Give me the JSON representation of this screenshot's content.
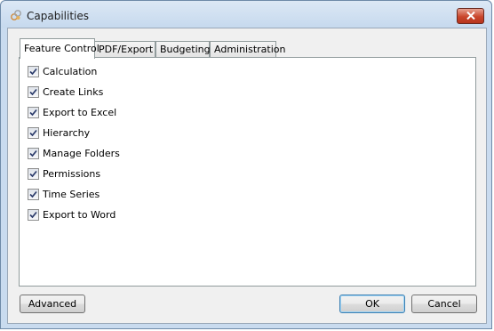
{
  "window": {
    "title": "Capabilities"
  },
  "tabs": [
    "Feature Control",
    "PDF/Export",
    "Budgeting",
    "Administration"
  ],
  "features": [
    {
      "label": "Calculation",
      "checked": true
    },
    {
      "label": "Create Links",
      "checked": true
    },
    {
      "label": "Export to Excel",
      "checked": true
    },
    {
      "label": "Hierarchy",
      "checked": true
    },
    {
      "label": "Manage Folders",
      "checked": true
    },
    {
      "label": "Permissions",
      "checked": true
    },
    {
      "label": "Time Series",
      "checked": true
    },
    {
      "label": "Export to Word",
      "checked": true
    }
  ],
  "buttons": {
    "advanced": "Advanced",
    "ok": "OK",
    "cancel": "Cancel"
  },
  "colors": {
    "close_button": "#c9462c",
    "checkmark": "#2a3a6a"
  }
}
